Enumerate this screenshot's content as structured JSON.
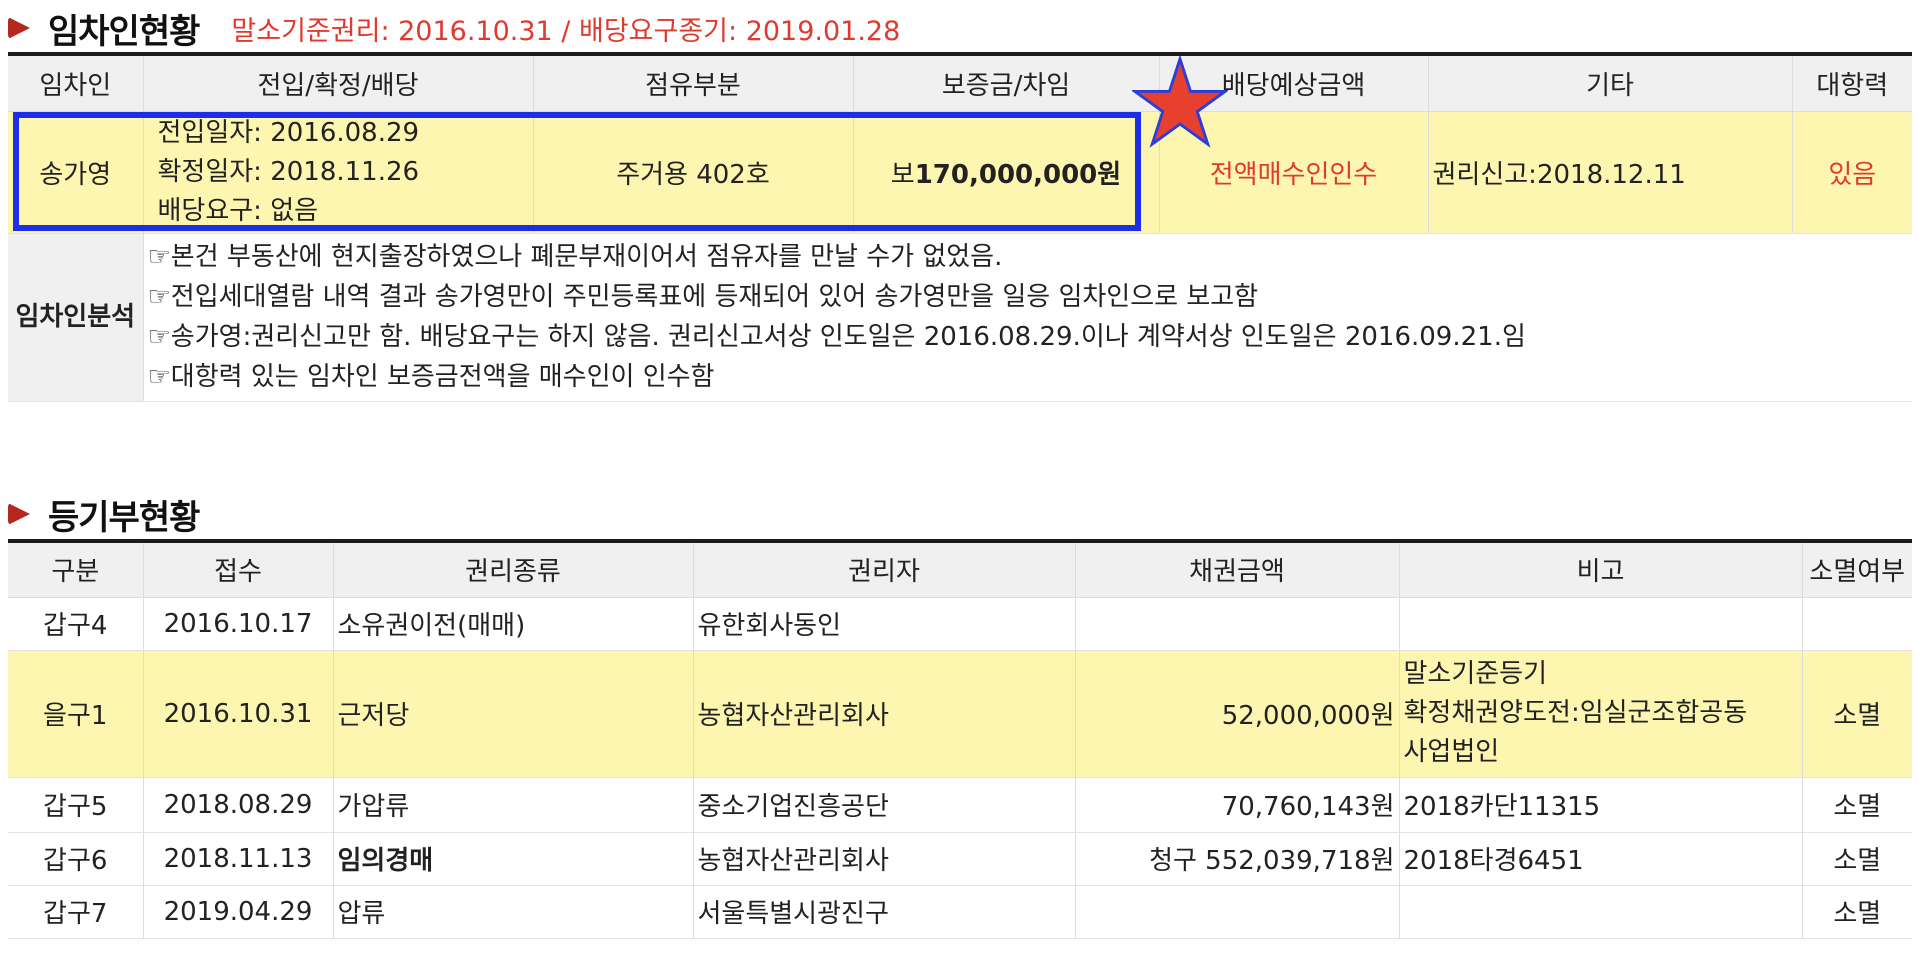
{
  "tenant_section": {
    "title": "임차인현황",
    "subtitle": "말소기준권리: 2016.10.31 / 배당요구종기: 2019.01.28",
    "headers": [
      "임차인",
      "전입/확정/배당",
      "점유부분",
      "보증금/차임",
      "배당예상금액",
      "기타",
      "대항력"
    ],
    "row": {
      "name": "송가영",
      "move_in": "전입일자: 2016.08.29",
      "fixed_date": "확정일자: 2018.11.26",
      "dividend_request": "배당요구: 없음",
      "occupancy": "주거용 402호",
      "deposit_prefix": "보",
      "deposit_amount": "170,000,000원",
      "expected_dividend": "전액매수인인수",
      "other": "권리신고:2018.12.11",
      "opposing_power": "있음"
    },
    "analysis_label": "임차인분석",
    "analysis_notes": [
      "☞본건 부동산에 현지출장하였으나 폐문부재이어서 점유자를 만날 수가 없었음.",
      "☞전입세대열람 내역 결과 송가영만이 주민등록표에 등재되어 있어 송가영만을 일응 임차인으로 보고함",
      "☞송가영:권리신고만 함. 배당요구는 하지 않음. 권리신고서상 인도일은 2016.08.29.이나 계약서상 인도일은 2016.09.21.임",
      "☞대항력 있는 임차인 보증금전액을 매수인이 인수함"
    ]
  },
  "registry_section": {
    "title": "등기부현황",
    "headers": [
      "구분",
      "접수",
      "권리종류",
      "권리자",
      "채권금액",
      "비고",
      "소멸여부"
    ],
    "rows": [
      {
        "type": "갑구4",
        "date": "2016.10.17",
        "right": "소유권이전(매매)",
        "holder": "유한회사동인",
        "amount": "",
        "note": [],
        "extinct": ""
      },
      {
        "type": "을구1",
        "date": "2016.10.31",
        "right": "근저당",
        "holder": "농협자산관리회사",
        "amount": "52,000,000원",
        "note": [
          "말소기준등기",
          "확정채권양도전:임실군조합공동",
          "사업법인"
        ],
        "extinct": "소멸"
      },
      {
        "type": "갑구5",
        "date": "2018.08.29",
        "right": "가압류",
        "holder": "중소기업진흥공단",
        "amount": "70,760,143원",
        "note": [
          "2018카단11315"
        ],
        "extinct": "소멸"
      },
      {
        "type": "갑구6",
        "date": "2018.11.13",
        "right": "임의경매",
        "holder": "농협자산관리회사",
        "amount": "청구 552,039,718원",
        "note": [
          "2018타경6451"
        ],
        "extinct": "소멸"
      },
      {
        "type": "갑구7",
        "date": "2019.04.29",
        "right": "압류",
        "holder": "서울특별시광진구",
        "amount": "",
        "note": [],
        "extinct": "소멸"
      }
    ]
  },
  "annotations": {
    "highlight_box_color": "#1e2ee6",
    "star_fill": "#e8402e",
    "star_stroke": "#2b3fd8"
  }
}
